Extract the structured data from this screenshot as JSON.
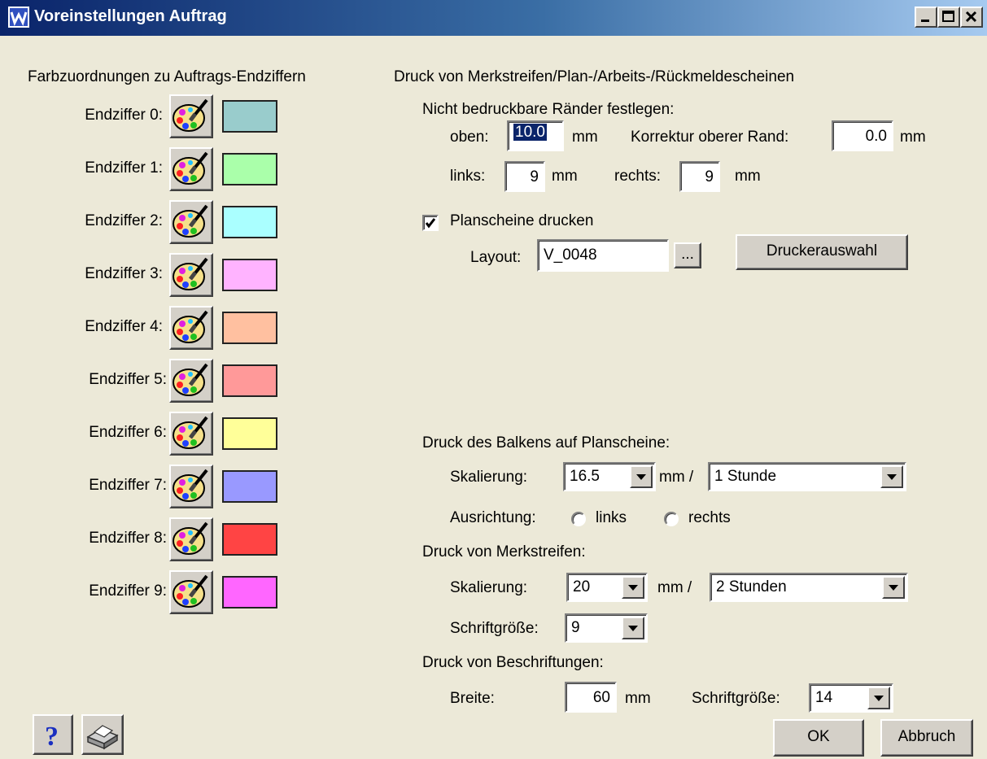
{
  "window": {
    "title": "Voreinstellungen Auftrag"
  },
  "colors": {
    "section_title": "Farbzuordnungen zu Auftrags-Endziffern",
    "items": [
      {
        "label": "Endziffer 0:",
        "color": "#99cccc"
      },
      {
        "label": "Endziffer 1:",
        "color": "#aaffaa"
      },
      {
        "label": "Endziffer 2:",
        "color": "#aaffff"
      },
      {
        "label": "Endziffer 3:",
        "color": "#ffb3ff"
      },
      {
        "label": "Endziffer 4:",
        "color": "#ffc0a0"
      },
      {
        "label": "Endziffer 5:",
        "color": "#ff9999"
      },
      {
        "label": "Endziffer 6:",
        "color": "#ffff99"
      },
      {
        "label": "Endziffer 7:",
        "color": "#9999ff"
      },
      {
        "label": "Endziffer 8:",
        "color": "#ff4444"
      },
      {
        "label": "Endziffer 9:",
        "color": "#ff66ff"
      }
    ]
  },
  "print": {
    "section_title": "Druck von Merkstreifen/Plan-/Arbeits-/Rückmeldescheinen",
    "margins_title": "Nicht bedruckbare Ränder festlegen:",
    "oben_label": "oben:",
    "oben_value": "10.0",
    "mm": "mm",
    "korrektur_label": "Korrektur oberer Rand:",
    "korrektur_value": "0.0",
    "links_label": "links:",
    "links_value": "9",
    "rechts_label": "rechts:",
    "rechts_value": "9",
    "planscheine_label": "Planscheine drucken",
    "planscheine_checked": true,
    "layout_label": "Layout:",
    "layout_value": "V_0048",
    "browse_label": "...",
    "druckerauswahl_label": "Druckerauswahl"
  },
  "balken": {
    "title": "Druck des Balkens auf Planscheine:",
    "skalierung_label": "Skalierung:",
    "skalierung_value": "16.5",
    "mm_per": "mm /",
    "unit_value": "1 Stunde",
    "ausrichtung_label": "Ausrichtung:",
    "links_option": "links",
    "rechts_option": "rechts"
  },
  "merkstreifen": {
    "title": "Druck von Merkstreifen:",
    "skalierung_label": "Skalierung:",
    "skalierung_value": "20",
    "mm_per": "mm /",
    "unit_value": "2 Stunden",
    "schriftgroesse_label": "Schriftgröße:",
    "schriftgroesse_value": "9"
  },
  "beschriftungen": {
    "title": "Druck von Beschriftungen:",
    "breite_label": "Breite:",
    "breite_value": "60",
    "mm": "mm",
    "schriftgroesse_label": "Schriftgröße:",
    "schriftgroesse_value": "14"
  },
  "footer": {
    "ok_label": "OK",
    "cancel_label": "Abbruch"
  }
}
